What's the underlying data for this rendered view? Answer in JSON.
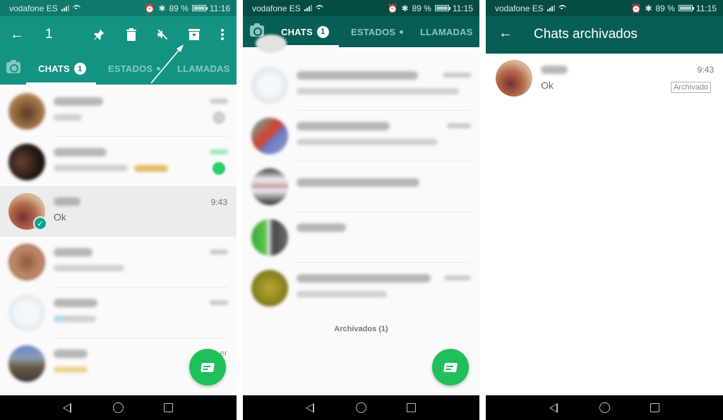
{
  "colors": {
    "header_selection": "#149383",
    "header_dark": "#075e54",
    "statusbar_dark": "#054d44",
    "accent_green": "#1fbf5a",
    "check_teal": "#10a28c"
  },
  "statusbar": {
    "carrier": "vodafone ES",
    "battery": "89 %",
    "panels": [
      {
        "time": "11:16"
      },
      {
        "time": "11:15"
      },
      {
        "time": "11:15"
      }
    ]
  },
  "panel1": {
    "selection_count": "1",
    "actions": [
      "back-icon",
      "pin-icon",
      "delete-icon",
      "mute-icon",
      "archive-icon",
      "more-icon"
    ],
    "tabs": {
      "chats": "CHATS",
      "chats_badge": "1",
      "estados": "ESTADOS",
      "llamadas": "LLAMADAS"
    },
    "chats": [
      {
        "name": "(blurred)",
        "time": "(blurred)",
        "preview": "(blurred)"
      },
      {
        "name": "(blurred)",
        "time": "(blurred)",
        "preview": "(blurred)"
      },
      {
        "name": "(blurred)",
        "time": "9:43",
        "preview": "Ok",
        "selected": true
      },
      {
        "name": "(blurred)",
        "time": "(blurred)",
        "preview": "(blurred)"
      },
      {
        "name": "(blurred)",
        "time": "(blurred)",
        "preview": "(blurred)"
      },
      {
        "name": "(blurred)",
        "time": "er",
        "preview": "(blurred)"
      }
    ]
  },
  "panel2": {
    "tabs": {
      "chats": "CHATS",
      "chats_badge": "1",
      "estados": "ESTADOS",
      "llamadas": "LLAMADAS"
    },
    "archived_link": "Archivados (1)"
  },
  "panel3": {
    "title": "Chats archivados",
    "chat": {
      "time": "9:43",
      "preview": "Ok",
      "tag": "Archivado"
    }
  },
  "icons": {
    "back": "←",
    "pin": "📌",
    "check": "✓"
  }
}
